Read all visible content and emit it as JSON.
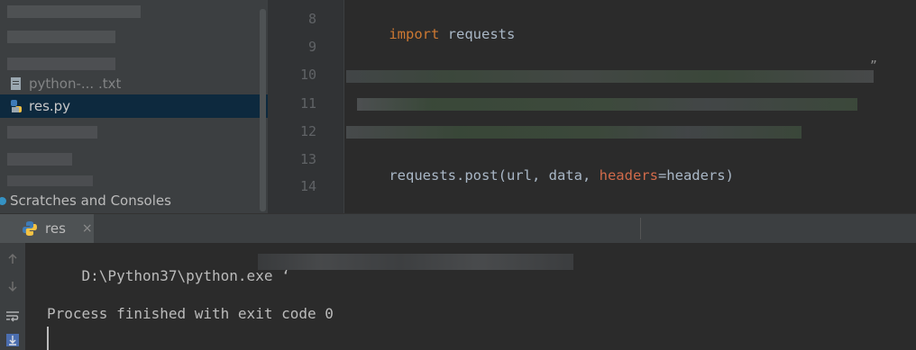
{
  "project": {
    "items": [
      {
        "label": "python-... .txt",
        "icon": "text-file-icon"
      },
      {
        "label": "res.py",
        "icon": "python-file-icon",
        "selected": true
      }
    ],
    "scratches_label": "Scratches and Consoles"
  },
  "editor": {
    "line_numbers": [
      "8",
      "9",
      "10",
      "11",
      "12",
      "13",
      "14"
    ],
    "lines": {
      "import_kw": "import",
      "import_rest": " requests",
      "call_prefix": "requests.post(url, data, ",
      "call_param": "headers",
      "call_suffix": "=headers)",
      "stray_quote": "”"
    }
  },
  "run": {
    "tab_label": "res",
    "close_glyph": "×",
    "output": [
      "D:\\Python37\\python.exe ʻ",
      "",
      "Process finished with exit code 0"
    ]
  },
  "colors": {
    "keyword": "#cc7832",
    "named_param": "#d06a4a",
    "selection": "#0d293e",
    "text": "#a9b7c6"
  }
}
